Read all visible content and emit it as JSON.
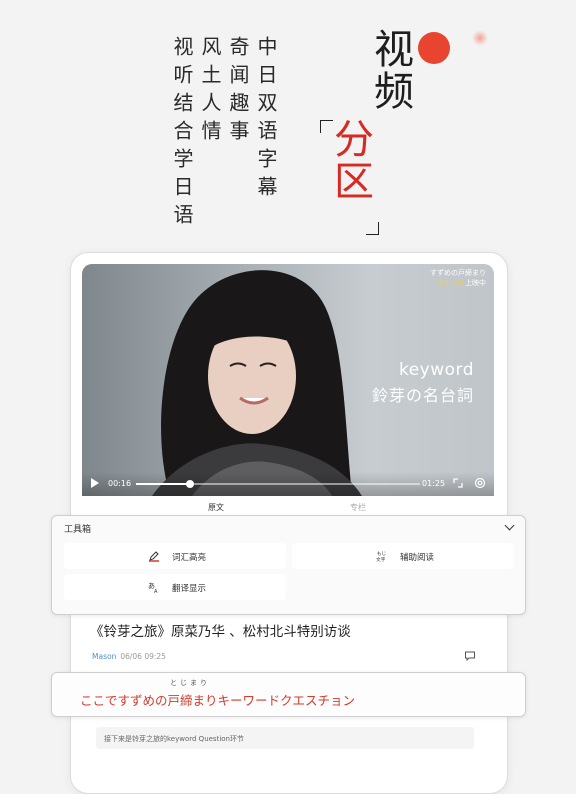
{
  "promo": {
    "columns": [
      "中日双语字幕",
      "奇闻趣事",
      "风土人情",
      "视听结合学日语"
    ],
    "title_black": "视频",
    "title_red": "分区"
  },
  "video": {
    "overlay_line1": "すずめの戸締まり",
    "overlay_line2_highlight": "大ヒット",
    "overlay_line2_rest": "上映中",
    "keyword_line1": "keyword",
    "keyword_line2": "鈴芽の名台詞",
    "current_time": "00:16",
    "total_time": "01:25",
    "progress": 0.19
  },
  "tabs": [
    "原文",
    "专栏"
  ],
  "toolbox": {
    "title": "工具箱",
    "buttons": [
      {
        "label": "词汇高亮",
        "icon": "highlight-pen-icon"
      },
      {
        "label": "辅助阅读",
        "icon": "furigana-icon"
      },
      {
        "label": "翻译显示",
        "icon": "translate-icon"
      }
    ]
  },
  "article": {
    "title": "《铃芽之旅》原菜乃华 、松村北斗特别访谈",
    "author": "Mason",
    "date": "06/06 09:25",
    "keyword_furigana": "とじまり",
    "keyword_sentence": "ここですずめの戸締まりキーワードクエスチョン",
    "note": "接下来是铃芽之旅的keyword Question环节"
  },
  "colors": {
    "accent_red": "#d62a22",
    "link_blue": "#4a8fd6",
    "sun": "#e8442f"
  }
}
